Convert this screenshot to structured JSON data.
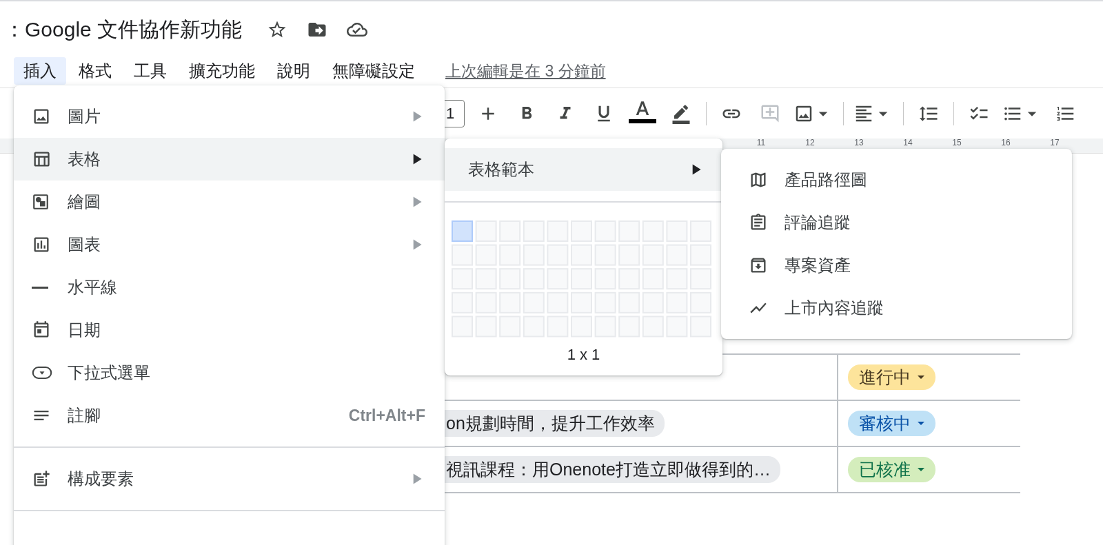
{
  "document_title": "：Google 文件協作新功能",
  "menu_bar": {
    "items": [
      {
        "label": "插入",
        "selected": true
      },
      {
        "label": "格式",
        "selected": false
      },
      {
        "label": "工具",
        "selected": false
      },
      {
        "label": "擴充功能",
        "selected": false
      },
      {
        "label": "說明",
        "selected": false
      },
      {
        "label": "無障礙設定",
        "selected": false
      }
    ],
    "last_edit_link": "上次編輯是在 3 分鐘前"
  },
  "toolbar": {
    "font_size": "1",
    "buttons": [
      {
        "kind": "plus"
      },
      {
        "kind": "bold"
      },
      {
        "kind": "italic"
      },
      {
        "kind": "underline"
      },
      {
        "kind": "text_color"
      },
      {
        "kind": "highlight"
      },
      {
        "kind": "divider"
      },
      {
        "kind": "link"
      },
      {
        "kind": "comment",
        "disabled": true
      },
      {
        "kind": "image"
      },
      {
        "kind": "divider"
      },
      {
        "kind": "align"
      },
      {
        "kind": "divider"
      },
      {
        "kind": "line_spacing"
      },
      {
        "kind": "divider"
      },
      {
        "kind": "checklist"
      },
      {
        "kind": "bullets"
      },
      {
        "kind": "numbered"
      }
    ]
  },
  "ruler": {
    "labels": [
      "11",
      "12",
      "13",
      "14",
      "15",
      "16",
      "17"
    ]
  },
  "table": {
    "rows": [
      {
        "status": {
          "label": "進行中",
          "kind": "in_progress",
          "color": "#fde49b"
        }
      },
      {
        "task": "on規劃時間，提升工作效率",
        "status": {
          "label": "審核中",
          "kind": "review",
          "color": "#bfe1f6"
        }
      },
      {
        "task": "視訊課程：用Onenote打造立即做得到的…",
        "status": {
          "label": "已核准",
          "kind": "approved",
          "color": "#d4edbc"
        }
      }
    ]
  },
  "insert_menu": {
    "items": [
      {
        "kind": "image",
        "label": "圖片",
        "submenu": true,
        "selected": false
      },
      {
        "kind": "table",
        "label": "表格",
        "submenu": true,
        "selected": true
      },
      {
        "kind": "drawing",
        "label": "繪圖",
        "submenu": true,
        "selected": false
      },
      {
        "kind": "chart",
        "label": "圖表",
        "submenu": true,
        "selected": false
      },
      {
        "kind": "rule",
        "label": "水平線",
        "selected": false
      },
      {
        "kind": "date",
        "label": "日期",
        "selected": false
      },
      {
        "kind": "dropdown",
        "label": "下拉式選單",
        "selected": false
      },
      {
        "kind": "footnote",
        "label": "註腳",
        "shortcut": "Ctrl+Alt+F",
        "selected": false
      },
      {
        "kind": "divider"
      },
      {
        "kind": "blocks",
        "label": "構成要素",
        "submenu": true,
        "selected": false
      },
      {
        "kind": "divider"
      }
    ]
  },
  "table_submenu": {
    "items": [
      {
        "label": "表格範本",
        "selected": true
      }
    ],
    "grid_label": "1 x 1"
  },
  "templates_submenu": {
    "items": [
      {
        "kind": "map",
        "label": "產品路徑圖"
      },
      {
        "kind": "review",
        "label": "評論追蹤"
      },
      {
        "kind": "archive",
        "label": "專案資產"
      },
      {
        "kind": "trend",
        "label": "上市內容追蹤"
      }
    ]
  }
}
